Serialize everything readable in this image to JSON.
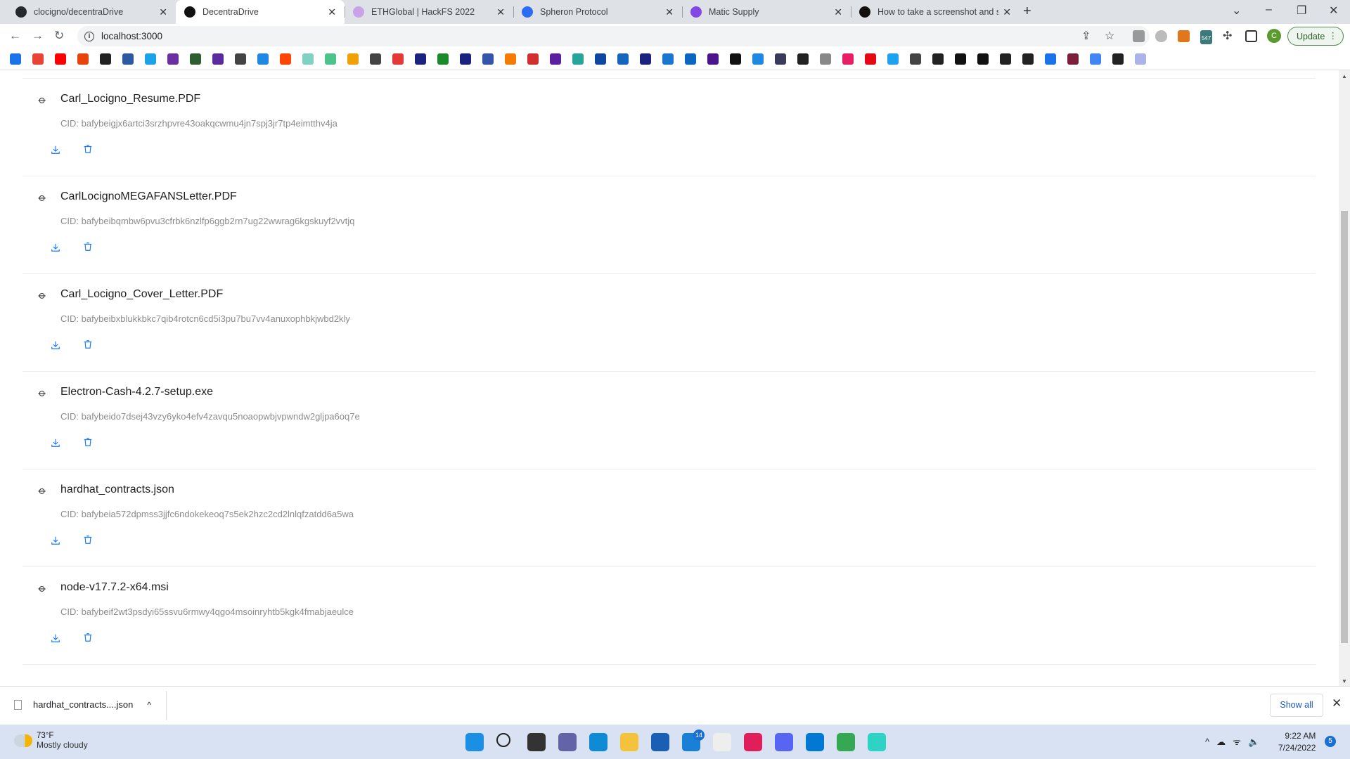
{
  "browser": {
    "tabs": [
      {
        "title": "clocigno/decentraDrive",
        "favicon": "github-icon",
        "color": "#24292f",
        "active": false
      },
      {
        "title": "DecentraDrive",
        "favicon": "decentradrive-icon",
        "color": "#111111",
        "active": true
      },
      {
        "title": "ETHGlobal | HackFS 2022",
        "favicon": "ethglobal-icon",
        "color": "#c9a3e8",
        "active": false
      },
      {
        "title": "Spheron Protocol",
        "favicon": "spheron-icon",
        "color": "#2b6cf5",
        "active": false
      },
      {
        "title": "Matic Supply",
        "favicon": "polygon-icon",
        "color": "#8247e5",
        "active": false
      },
      {
        "title": "How to take a screenshot and sa",
        "favicon": "g-icon",
        "color": "#111111",
        "active": false
      }
    ],
    "url": "localhost:3000",
    "update_label": "Update",
    "avatar_letter": "C",
    "extension_badge": "547",
    "bookmark_colors": [
      "#1a73e8",
      "#ea4335",
      "#ff0000",
      "#e8430a",
      "#222222",
      "#2c5aa0",
      "#1aa3e8",
      "#6b2fa0",
      "#2f5d2f",
      "#5b2ca0",
      "#444444",
      "#1e88e5",
      "#ff4500",
      "#7fd1c4",
      "#4cc38a",
      "#f0a000",
      "#444444",
      "#e53935",
      "#1a237e",
      "#1b8a2b",
      "#1a237e",
      "#3355aa",
      "#f57c00",
      "#d32f2f",
      "#5b1fa0",
      "#26a69a",
      "#0d47a1",
      "#1565c0",
      "#1a237e",
      "#1976d2",
      "#0a66c2",
      "#4a148c",
      "#111111",
      "#1e88e5",
      "#3a3a5a",
      "#222222",
      "#888888",
      "#e91e63",
      "#e50914",
      "#1da1f2",
      "#444444",
      "#222222",
      "#111111",
      "#111111",
      "#222222",
      "#222222",
      "#1a73e8",
      "#7b1f3a",
      "#4285f4",
      "#222222",
      "#aab4e8"
    ]
  },
  "files": [
    {
      "name": "Carl_Locigno_Resume.PDF",
      "cid": "CID: bafybeigjx6artci3srzhpvre43oakqcwmu4jn7spj3jr7tp4eimtthv4ja"
    },
    {
      "name": "CarlLocignoMEGAFANSLetter.PDF",
      "cid": "CID: bafybeibqmbw6pvu3cfrbk6nzlfp6ggb2rn7ug22wwrag6kgskuyf2vvtjq"
    },
    {
      "name": "Carl_Locigno_Cover_Letter.PDF",
      "cid": "CID: bafybeibxblukkbkc7qib4rotcn6cd5i3pu7bu7vv4anuxophbkjwbd2kly"
    },
    {
      "name": "Electron-Cash-4.2.7-setup.exe",
      "cid": "CID: bafybeido7dsej43vzy6yko4efv4zavqu5noaopwbjvpwndw2gljpa6oq7e"
    },
    {
      "name": "hardhat_contracts.json",
      "cid": "CID: bafybeia572dpmss3jjfc6ndokekeoq7s5ek2hzc2cd2lnlqfzatdd6a5wa"
    },
    {
      "name": "node-v17.7.2-x64.msi",
      "cid": "CID: bafybeif2wt3psdyi65ssvu6rmwy4qgo4msoinryhtb5kgk4fmabjaeulce"
    }
  ],
  "download_shelf": {
    "file": "hardhat_contracts....json",
    "show_all": "Show all"
  },
  "taskbar": {
    "temperature": "73°F",
    "weather": "Mostly cloudy",
    "time": "9:22 AM",
    "date": "7/24/2022",
    "notification_count": "5",
    "mail_badge": "14",
    "apps": [
      {
        "name": "start-icon",
        "color": "#1a8fe3"
      },
      {
        "name": "search-icon",
        "color": "#d9e2f3"
      },
      {
        "name": "task-view-icon",
        "color": "#333333"
      },
      {
        "name": "teams-chat-icon",
        "color": "#6264a7"
      },
      {
        "name": "edge-icon",
        "color": "#0f8bd6"
      },
      {
        "name": "file-explorer-icon",
        "color": "#f4c33d"
      },
      {
        "name": "store-icon",
        "color": "#1a5fb4"
      },
      {
        "name": "mail-icon",
        "color": "#1a7fd6"
      },
      {
        "name": "dell-icon",
        "color": "#eeeeee"
      },
      {
        "name": "slack-icon",
        "color": "#e01e5a"
      },
      {
        "name": "discord-icon",
        "color": "#5865f2"
      },
      {
        "name": "vscode-icon",
        "color": "#0078d4"
      },
      {
        "name": "chrome-icon",
        "color": "#34a853"
      },
      {
        "name": "cube-app-icon",
        "color": "#2ed3c6"
      }
    ]
  }
}
